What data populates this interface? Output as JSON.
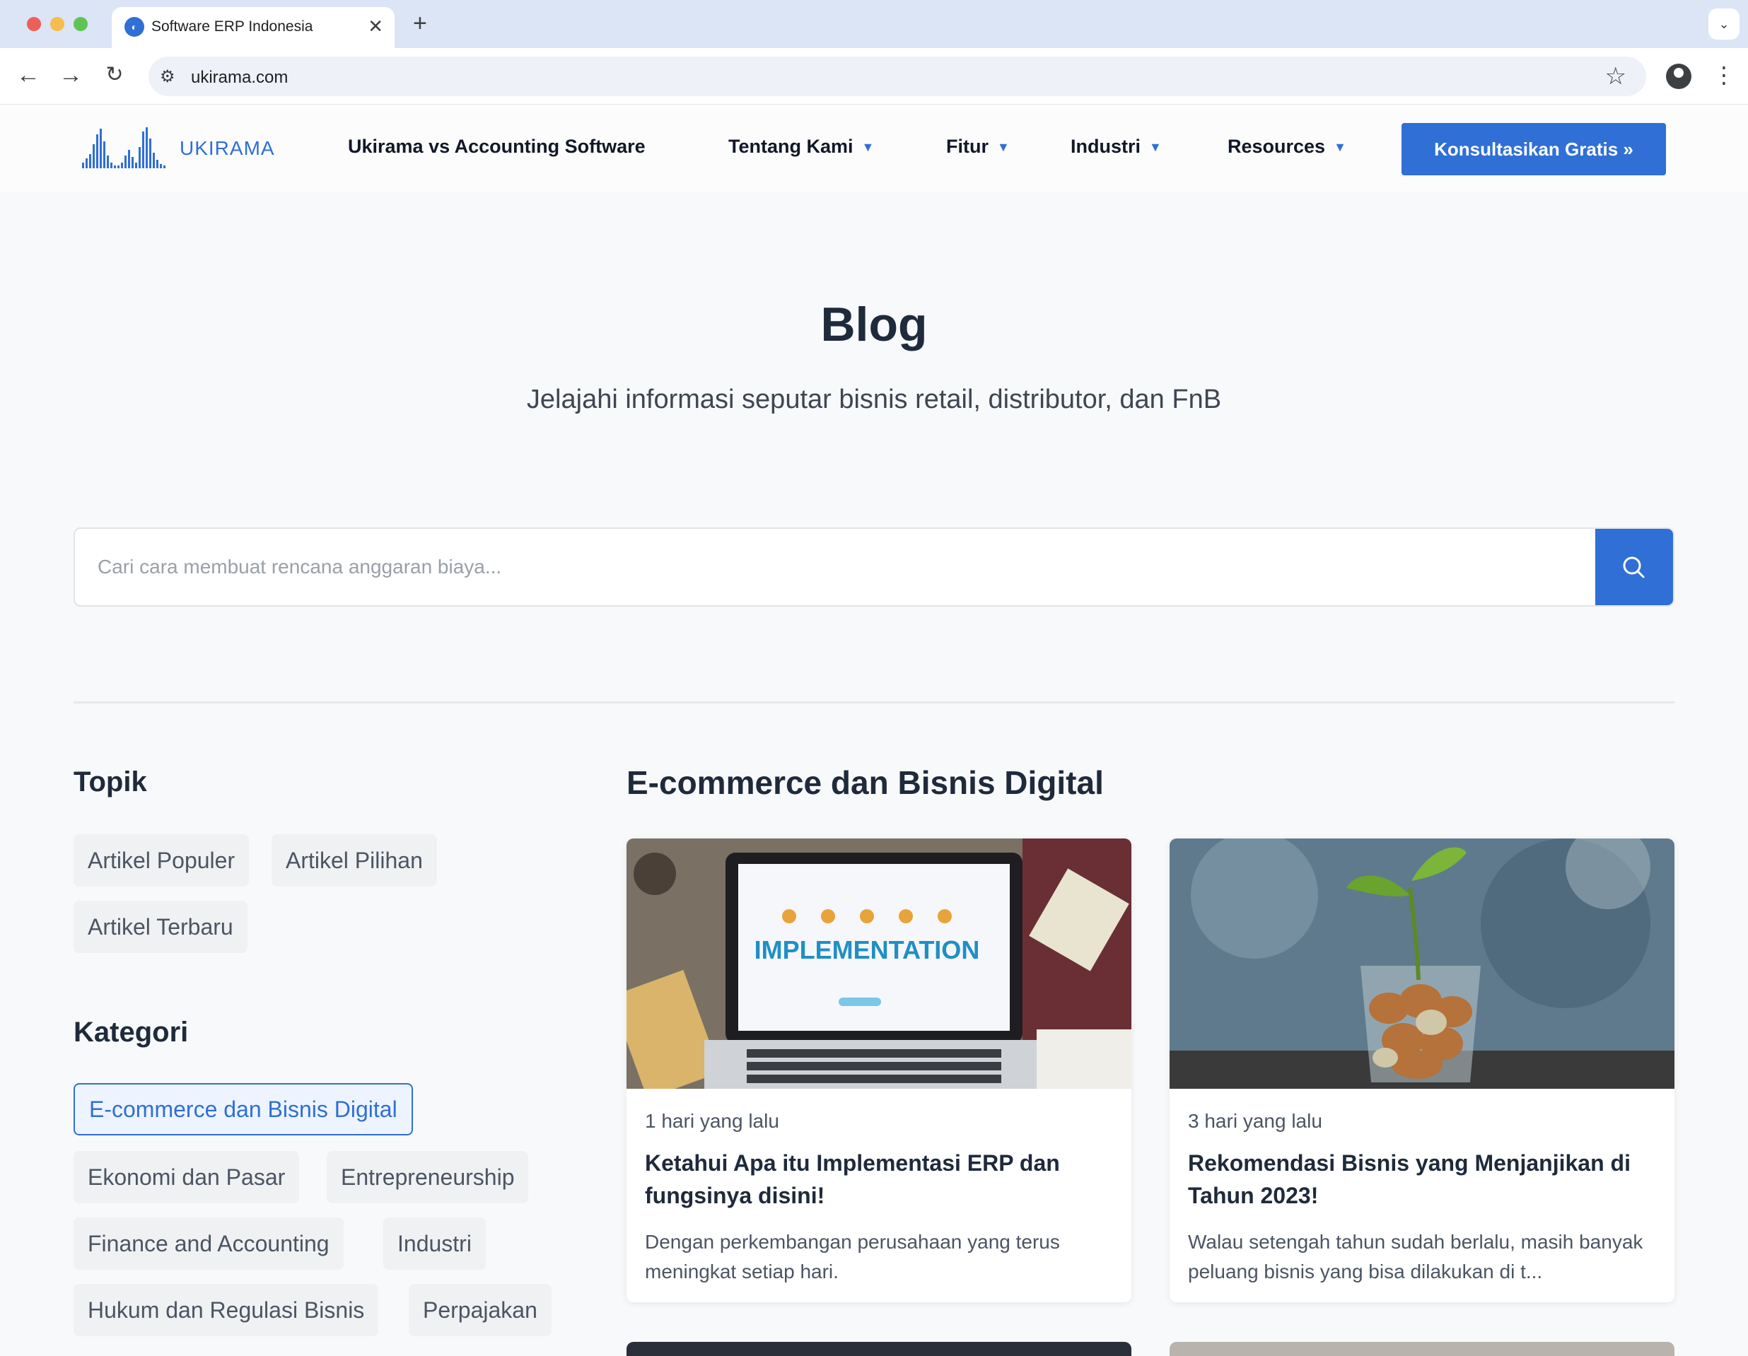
{
  "browser": {
    "tab_title": "Software ERP Indonesia",
    "url": "ukirama.com"
  },
  "header": {
    "logo_text": "UKIRAMA",
    "menu": [
      {
        "label": "Ukirama vs Accounting Software",
        "has_dropdown": false
      },
      {
        "label": "Tentang Kami",
        "has_dropdown": true
      },
      {
        "label": "Fitur",
        "has_dropdown": true
      },
      {
        "label": "Industri",
        "has_dropdown": true
      },
      {
        "label": "Resources",
        "has_dropdown": true
      }
    ],
    "cta_label": "Konsultasikan Gratis »"
  },
  "hero": {
    "title": "Blog",
    "subtitle": "Jelajahi informasi seputar bisnis retail, distributor, dan FnB"
  },
  "search": {
    "placeholder": "Cari cara membuat rencana anggaran biaya...",
    "value": ""
  },
  "sidebar": {
    "topics_heading": "Topik",
    "topics": [
      "Artikel Populer",
      "Artikel Pilihan",
      "Artikel Terbaru"
    ],
    "categories_heading": "Kategori",
    "categories": [
      {
        "label": "E-commerce dan Bisnis Digital",
        "active": true
      },
      {
        "label": "Ekonomi dan Pasar",
        "active": false
      },
      {
        "label": "Entrepreneurship",
        "active": false
      },
      {
        "label": "Finance and Accounting",
        "active": false
      },
      {
        "label": "Industri",
        "active": false
      },
      {
        "label": "Hukum dan Regulasi Bisnis",
        "active": false
      },
      {
        "label": "Perpajakan",
        "active": false
      }
    ]
  },
  "main": {
    "section_title": "E-commerce dan Bisnis Digital",
    "posts": [
      {
        "time": "1 hari yang lalu",
        "title": "Ketahui Apa itu Implementasi ERP dan fungsinya disini!",
        "excerpt": "Dengan perkembangan perusahaan yang terus meningkat setiap hari.",
        "image_text": "IMPLEMENTATION"
      },
      {
        "time": "3 hari yang lalu",
        "title": "Rekomendasi Bisnis yang Menjanjikan di Tahun 2023!",
        "excerpt": "Walau setengah tahun sudah berlalu, masih banyak peluang bisnis yang bisa dilakukan di t..."
      }
    ]
  },
  "colors": {
    "accent": "#2f6fd6",
    "heading": "#1f2a3b",
    "page_bg": "#f8f9fb"
  }
}
